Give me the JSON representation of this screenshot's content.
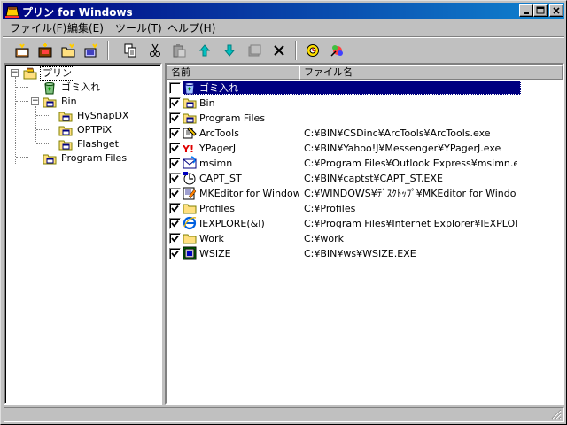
{
  "window": {
    "title": "プリン for Windows",
    "controls": [
      "minimize",
      "maximize",
      "close"
    ]
  },
  "menu": [
    {
      "label": "ファイル(F)"
    },
    {
      "label": "編集(E)"
    },
    {
      "label": "ツール(T)"
    },
    {
      "label": "ヘルプ(H)"
    }
  ],
  "toolbar": {
    "buttons": [
      {
        "name": "new-group-button",
        "icon": "new-group-icon"
      },
      {
        "name": "new-item-button",
        "icon": "new-item-icon"
      },
      {
        "name": "open-button",
        "icon": "open-icon"
      },
      {
        "name": "refresh-button",
        "icon": "refresh-icon"
      },
      {
        "name": "copy-button",
        "icon": "copy-icon"
      },
      {
        "name": "cut-button",
        "icon": "cut-icon"
      },
      {
        "name": "paste-button",
        "icon": "paste-icon"
      },
      {
        "name": "move-up-button",
        "icon": "arrow-up-icon"
      },
      {
        "name": "move-down-button",
        "icon": "arrow-down-icon"
      },
      {
        "name": "properties-button",
        "icon": "properties-icon"
      },
      {
        "name": "delete-button",
        "icon": "delete-icon"
      },
      {
        "name": "settings-button",
        "icon": "settings-icon"
      },
      {
        "name": "run-button",
        "icon": "run-icon"
      }
    ]
  },
  "tree": {
    "items": [
      {
        "label": "プリン",
        "level": 0,
        "expander": "−",
        "icon": "pudding-root-icon",
        "selected": true
      },
      {
        "label": "ゴミ入れ",
        "level": 1,
        "expander": "",
        "icon": "recycle-bin-icon"
      },
      {
        "label": "Bin",
        "level": 1,
        "expander": "−",
        "icon": "folder-program-icon"
      },
      {
        "label": "HySnapDX",
        "level": 2,
        "expander": "",
        "icon": "folder-program-icon"
      },
      {
        "label": "OPTPiX",
        "level": 2,
        "expander": "",
        "icon": "folder-program-icon"
      },
      {
        "label": "Flashget",
        "level": 2,
        "expander": "",
        "icon": "folder-program-icon"
      },
      {
        "label": "Program Files",
        "level": 1,
        "expander": "",
        "icon": "folder-program-icon"
      }
    ]
  },
  "list": {
    "columns": [
      {
        "label": "名前"
      },
      {
        "label": "ファイル名"
      }
    ],
    "rows": [
      {
        "name": "ゴミ入れ",
        "path": "",
        "checked": false,
        "selected": true,
        "icon": "recycle-bin-icon"
      },
      {
        "name": "Bin",
        "path": "",
        "checked": true,
        "selected": false,
        "icon": "folder-program-icon"
      },
      {
        "name": "Program Files",
        "path": "",
        "checked": true,
        "selected": false,
        "icon": "folder-program-icon"
      },
      {
        "name": "ArcTools",
        "path": "C:¥BIN¥CSDinc¥ArcTools¥ArcTools.exe",
        "checked": true,
        "selected": false,
        "icon": "arctools-icon"
      },
      {
        "name": "YPagerJ",
        "path": "C:¥BIN¥Yahoo!J¥Messenger¥YPagerJ.exe",
        "checked": true,
        "selected": false,
        "icon": "yahoo-pager-icon"
      },
      {
        "name": "msimn",
        "path": "C:¥Program Files¥Outlook Express¥msimn.exe",
        "checked": true,
        "selected": false,
        "icon": "outlook-express-icon"
      },
      {
        "name": "CAPT_ST",
        "path": "C:¥BIN¥captst¥CAPT_ST.EXE",
        "checked": true,
        "selected": false,
        "icon": "capture-icon"
      },
      {
        "name": "MKEditor for Window...",
        "path": "C:¥WINDOWS¥ﾃﾞｽｸﾄｯﾌﾟ¥MKEditor for Window...",
        "checked": true,
        "selected": false,
        "icon": "mkeditor-icon"
      },
      {
        "name": "Profiles",
        "path": "C:¥Profiles",
        "checked": true,
        "selected": false,
        "icon": "folder-icon"
      },
      {
        "name": "IEXPLORE(&I)",
        "path": "C:¥Program Files¥Internet Explorer¥IEXPLOR...",
        "checked": true,
        "selected": false,
        "icon": "internet-explorer-icon"
      },
      {
        "name": "Work",
        "path": "C:¥work",
        "checked": true,
        "selected": false,
        "icon": "folder-icon"
      },
      {
        "name": "WSIZE",
        "path": "C:¥BIN¥ws¥WSIZE.EXE",
        "checked": true,
        "selected": false,
        "icon": "wsize-icon"
      }
    ]
  },
  "status": {
    "text": ""
  },
  "colors": {
    "title_start": "#000080",
    "title_end": "#1084d0",
    "face": "#c0c0c0",
    "selection": "#000080"
  }
}
